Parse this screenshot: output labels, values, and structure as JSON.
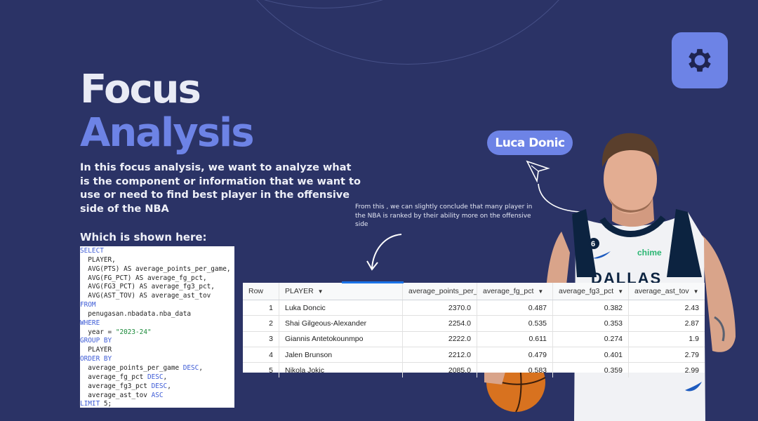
{
  "title_line1": "Focus",
  "title_line2": "Analysis",
  "intro": "In this focus analysis, we want to analyze what is the component or information that we want to use or need to find best player in the offensive side of the NBA",
  "shown_label": "Which is shown here:",
  "sql_lines": [
    "SELECT",
    "  PLAYER,",
    "  AVG(PTS) AS average_points_per_game,",
    "  AVG(FG_PCT) AS average_fg_pct,",
    "  AVG(FG3_PCT) AS average_fg3_pct,",
    "  AVG(AST_TOV) AS average_ast_tov",
    "FROM",
    "  penugasan.nbadata.nba_data",
    "WHERE",
    "  year = \"2023-24\"",
    "GROUP BY",
    "  PLAYER",
    "ORDER BY",
    "  average_points_per_game DESC,",
    "  average_fg_pct DESC,",
    "  average_fg3_pct DESC,",
    "  average_ast_tov ASC",
    "LIMIT 5;"
  ],
  "note": "From this , we can slightly conclude that many player in the NBA is ranked by their ability more on the offensive side",
  "player_badge": "Luca Donic",
  "jersey_brand": "chime",
  "jersey_number": "6",
  "jersey_text": "DALLAS",
  "settings_icon": "gear-icon",
  "accent_color": "#6d83e6",
  "background_color": "#2b3366",
  "table": {
    "headers": [
      "Row",
      "PLAYER",
      "average_points_per_",
      "average_fg_pct",
      "average_fg3_pct",
      "average_ast_tov"
    ],
    "rows": [
      [
        "1",
        "Luka Doncic",
        "2370.0",
        "0.487",
        "0.382",
        "2.43"
      ],
      [
        "2",
        "Shai Gilgeous-Alexander",
        "2254.0",
        "0.535",
        "0.353",
        "2.87"
      ],
      [
        "3",
        "Giannis Antetokounmpo",
        "2222.0",
        "0.611",
        "0.274",
        "1.9"
      ],
      [
        "4",
        "Jalen Brunson",
        "2212.0",
        "0.479",
        "0.401",
        "2.79"
      ],
      [
        "5",
        "Nikola Jokic",
        "2085.0",
        "0.583",
        "0.359",
        "2.99"
      ]
    ]
  }
}
